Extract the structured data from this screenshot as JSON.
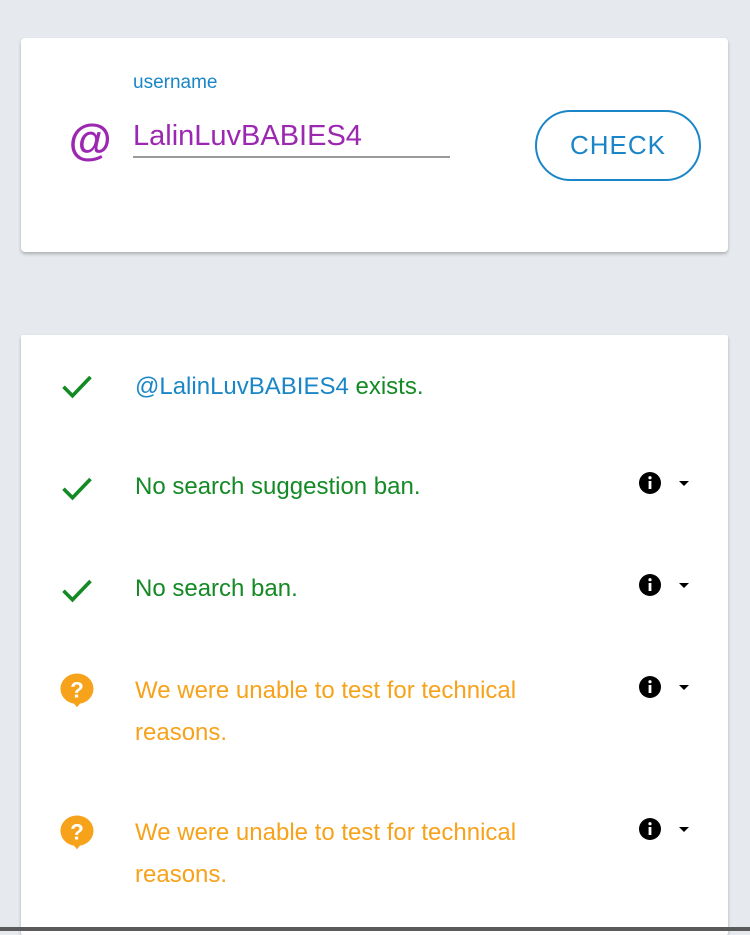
{
  "search": {
    "at_symbol": "@",
    "field_label": "username",
    "username_value": "LalinLuvBABIES4",
    "check_label": "CHECK"
  },
  "results": {
    "exists": {
      "handle": "@LalinLuvBABIES4",
      "suffix": " exists.",
      "icon": "check-icon",
      "status": "pass"
    },
    "suggestion_ban": {
      "text": "No search suggestion ban.",
      "icon": "check-icon",
      "status": "pass"
    },
    "search_ban": {
      "text": "No search ban.",
      "icon": "check-icon",
      "status": "pass"
    },
    "test_one": {
      "line1": "We were unable to test for technical",
      "line2": "reasons.",
      "icon": "question-icon",
      "status": "unknown"
    },
    "test_two": {
      "line1": "We were unable to test for technical",
      "line2": "reasons.",
      "icon": "question-icon",
      "status": "unknown"
    }
  },
  "colors": {
    "accent_blue": "#1a86c7",
    "purple": "#9c27b0",
    "pass_green": "#148a25",
    "warning_orange": "#f7a21b",
    "background": "#e6eaee"
  }
}
